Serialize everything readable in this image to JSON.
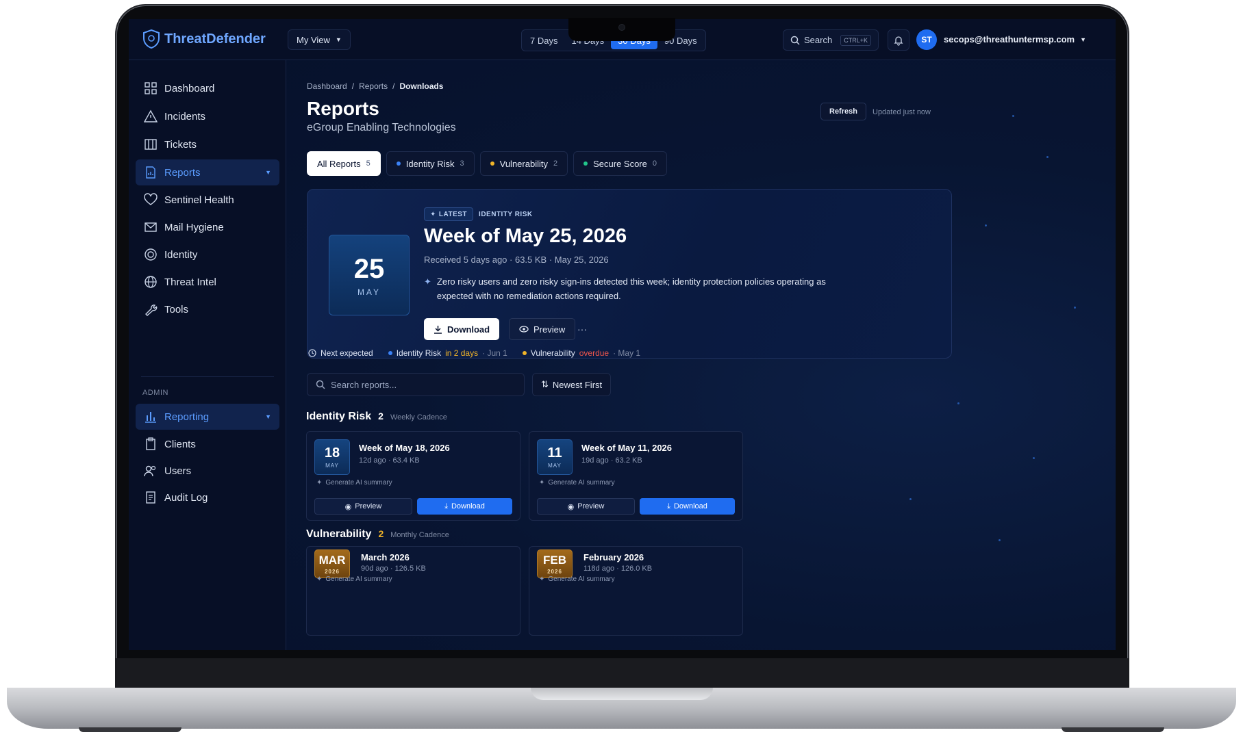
{
  "topbar": {
    "logo": "ThreatDefender",
    "view_label": "My View",
    "ranges": [
      "7 Days",
      "14 Days",
      "30 Days",
      "90 Days"
    ],
    "active_range": "30 Days",
    "search_label": "Search",
    "search_kbd": "CTRL+K",
    "user_initials": "ST",
    "user_email": "secops@threathuntermsp.com"
  },
  "sidebar": {
    "items": [
      "Dashboard",
      "Incidents",
      "Tickets",
      "Reports",
      "Sentinel Health",
      "Mail Hygiene",
      "Identity",
      "Threat Intel",
      "Tools"
    ],
    "admin_label": "ADMIN",
    "admin_items": [
      "Reporting",
      "Clients",
      "Users",
      "Audit Log"
    ]
  },
  "breadcrumb": [
    "Dashboard",
    "Reports",
    "Downloads"
  ],
  "page": {
    "title": "Reports",
    "subtitle": "eGroup Enabling Technologies",
    "refresh_label": "Refresh",
    "updated_label": "Updated just now"
  },
  "filters": [
    {
      "label": "All Reports",
      "count": "5",
      "color": ""
    },
    {
      "label": "Identity Risk",
      "count": "3",
      "color": "#3b82f6"
    },
    {
      "label": "Vulnerability",
      "count": "2",
      "color": "#f0b429"
    },
    {
      "label": "Secure Score",
      "count": "0",
      "color": "#22c58b"
    }
  ],
  "hero": {
    "day": "25",
    "month": "MAY",
    "latest_tag": "LATEST",
    "type_tag": "IDENTITY RISK",
    "title": "Week of May 25, 2026",
    "meta": "Received 5 days ago · 63.5 KB · May 25, 2026",
    "summary": "Zero risky users and zero risky sign-ins detected this week; identity protection policies operating as expected with no remediation actions required.",
    "download_label": "Download",
    "preview_label": "Preview",
    "more_label": "···"
  },
  "next_expected": {
    "label": "Next expected",
    "item1_name": "Identity Risk",
    "item1_status": "in 2 days",
    "item1_date": "· Jun 1",
    "item2_name": "Vulnerability",
    "item2_status": "overdue",
    "item2_date": "· May 1"
  },
  "search_reports": {
    "placeholder": "Search reports..."
  },
  "sort_label": "Newest First",
  "identity_section": {
    "name": "Identity Risk",
    "count": "2",
    "cadence": "Weekly Cadence",
    "cards": [
      {
        "day": "18",
        "month": "MAY",
        "title": "Week of May 18, 2026",
        "meta": "12d ago · 63.4 KB",
        "ai": "Generate AI summary",
        "preview": "Preview",
        "download": "Download"
      },
      {
        "day": "11",
        "month": "MAY",
        "title": "Week of May 11, 2026",
        "meta": "19d ago · 63.2 KB",
        "ai": "Generate AI summary",
        "preview": "Preview",
        "download": "Download"
      }
    ]
  },
  "vuln_section": {
    "name": "Vulnerability",
    "count": "2",
    "cadence": "Monthly Cadence",
    "cards": [
      {
        "day": "MAR",
        "month": "2026",
        "title": "March 2026",
        "meta": "90d ago · 126.5 KB",
        "ai": "Generate AI summary"
      },
      {
        "day": "FEB",
        "month": "2026",
        "title": "February 2026",
        "meta": "118d ago · 126.0 KB",
        "ai": "Generate AI summary"
      }
    ]
  }
}
